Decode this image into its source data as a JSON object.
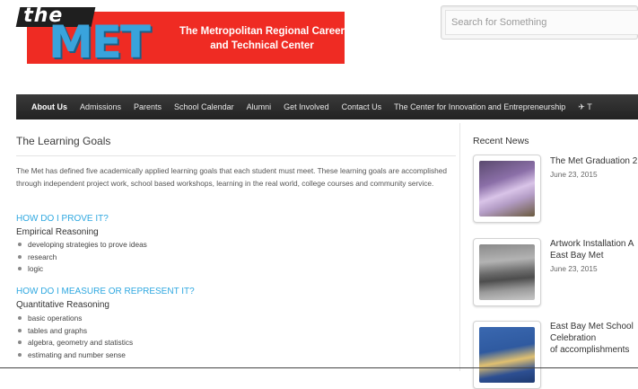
{
  "logo": {
    "the": "the",
    "met": "MET",
    "line1": "The Metropolitan Regional Career",
    "line2": "and Technical Center"
  },
  "search": {
    "placeholder": "Search for Something"
  },
  "nav": {
    "items": [
      "About Us",
      "Admissions",
      "Parents",
      "School Calendar",
      "Alumni",
      "Get Involved",
      "Contact Us",
      "The Center for Innovation and Entrepreneurship"
    ],
    "trailing": "T"
  },
  "main": {
    "title": "The Learning Goals",
    "intro": "The Met has defined five academically applied learning goals that each student must meet.  These learning goals are accomplished through independent project work, school based workshops, learning in the real world, college courses and community service.",
    "sections": [
      {
        "heading": "HOW DO I PROVE IT?",
        "subheading": "Empirical Reasoning",
        "items": [
          "developing strategies to prove ideas",
          "research",
          "logic"
        ]
      },
      {
        "heading": "HOW DO I MEASURE OR REPRESENT IT?",
        "subheading": "Quantitative Reasoning",
        "items": [
          "basic operations",
          "tables and graphs",
          "algebra, geometry and statistics",
          "estimating and number sense"
        ]
      }
    ]
  },
  "sidebar": {
    "title": "Recent News",
    "news": [
      {
        "title1": "The Met Graduation 2",
        "title2": "",
        "title3": "",
        "date": "June 23, 2015"
      },
      {
        "title1": "Artwork Installation A",
        "title2": "East Bay Met",
        "title3": "",
        "date": "June 23, 2015"
      },
      {
        "title1": "East Bay Met School",
        "title2": "Celebration",
        "title3": "of accomplishments",
        "date": ""
      }
    ]
  },
  "colors": {
    "accent": "#2fa8e0",
    "logo_red": "#ef2b23",
    "logo_blue": "#39a3dc",
    "nav_bg": "#2b2b2b"
  }
}
